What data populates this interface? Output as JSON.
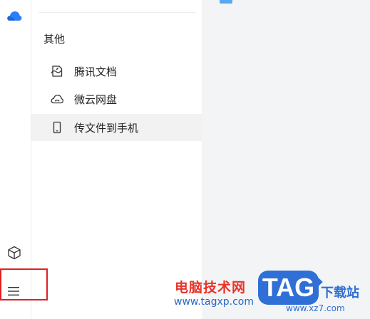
{
  "sidebar": {
    "section_title": "其他",
    "items": [
      {
        "label": "腾讯文档",
        "icon": "tencent-docs-icon",
        "active": false
      },
      {
        "label": "微云网盘",
        "icon": "cloud-drive-icon",
        "active": false
      },
      {
        "label": "传文件到手机",
        "icon": "phone-icon",
        "active": true
      }
    ]
  },
  "colors": {
    "accent": "#3d8bff",
    "highlight_border": "#e02020",
    "active_item_bg": "#f2f2f3",
    "main_bg": "#f3f4f6"
  },
  "watermark": {
    "site_name": "电脑技术网",
    "url": "www.tagxp.com",
    "logo_text": "TAG",
    "download_text": "下载站",
    "site_url": "www.xz7.com"
  }
}
